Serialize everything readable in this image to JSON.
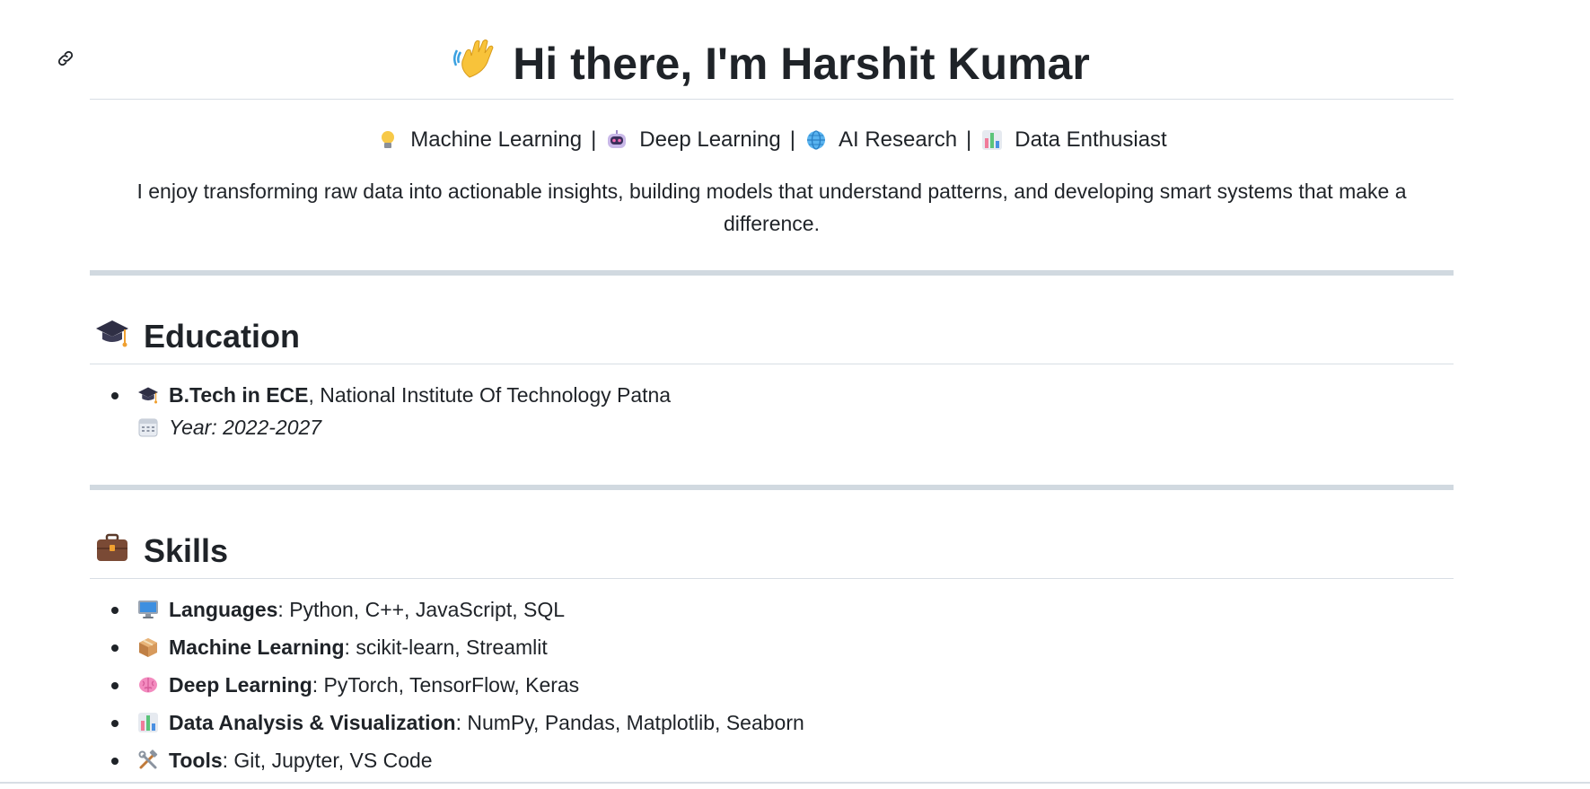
{
  "header": {
    "title": "Hi there, I'm Harshit Kumar",
    "title_icon": "waving-hand-icon"
  },
  "tagline": [
    {
      "icon": "lightbulb-icon",
      "label": "Machine Learning"
    },
    {
      "icon": "robot-icon",
      "label": "Deep Learning"
    },
    {
      "icon": "globe-icon",
      "label": "AI Research"
    },
    {
      "icon": "bar-chart-icon",
      "label": "Data Enthusiast"
    }
  ],
  "separator": "|",
  "intro": "I enjoy transforming raw data into actionable insights, building models that understand patterns, and developing smart systems that make a difference.",
  "education": {
    "heading": "Education",
    "heading_icon": "graduation-cap-icon",
    "degree": "B.Tech in ECE",
    "institute": ", National Institute Of Technology Patna",
    "year": "Year: 2022-2027"
  },
  "skills": {
    "heading": "Skills",
    "heading_icon": "briefcase-icon",
    "items": [
      {
        "icon": "monitor-icon",
        "label": "Languages",
        "value": ": Python, C++, JavaScript, SQL"
      },
      {
        "icon": "package-icon",
        "label": "Machine Learning",
        "value": ": scikit-learn, Streamlit"
      },
      {
        "icon": "brain-icon",
        "label": "Deep Learning",
        "value": ": PyTorch, TensorFlow, Keras"
      },
      {
        "icon": "bar-chart-icon",
        "label": "Data Analysis & Visualization",
        "value": ": NumPy, Pandas, Matplotlib, Seaborn"
      },
      {
        "icon": "tools-icon",
        "label": "Tools",
        "value": ": Git, Jupyter, VS Code"
      }
    ]
  },
  "colors": {
    "text": "#1f2328",
    "rule": "#d1d9e0",
    "border": "#d8dee4"
  }
}
